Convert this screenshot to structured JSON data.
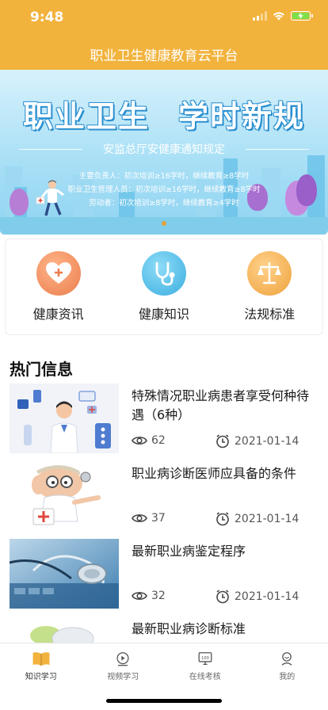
{
  "status_bar": {
    "time": "9:48"
  },
  "header": {
    "title": "职业卫生健康教育云平台"
  },
  "banner": {
    "title_left": "职业卫生",
    "title_right": "学时新规",
    "subtitle": "安监总厅安健康通知规定",
    "rules": [
      "主要负责人：初次培训≥16学时，继续教育≥8学时",
      "职业卫生管理人员：初次培训≥16学时，继续教育≥8学时",
      "劳动者：初次培训≥8学时，继续教育≥4学时"
    ]
  },
  "categories": [
    {
      "label": "健康资讯",
      "icon": "heart-plus-icon",
      "color": "#ef8e5c"
    },
    {
      "label": "健康知识",
      "icon": "stethoscope-icon",
      "color": "#45b8e6"
    },
    {
      "label": "法规标准",
      "icon": "scales-icon",
      "color": "#f1ac4a"
    }
  ],
  "section_title": "热门信息",
  "news": [
    {
      "title": "特殊情况职业病患者享受何种待遇（6种）",
      "views": "62",
      "date": "2021-01-14"
    },
    {
      "title": "职业病诊断医师应具备的条件",
      "views": "37",
      "date": "2021-01-14"
    },
    {
      "title": "最新职业病鉴定程序",
      "views": "32",
      "date": "2021-01-14"
    },
    {
      "title": "最新职业病诊断标准",
      "views": "",
      "date": ""
    }
  ],
  "tabbar": [
    {
      "label": "知识学习",
      "icon": "book-icon"
    },
    {
      "label": "视频学习",
      "icon": "video-play-icon"
    },
    {
      "label": "在线考核",
      "icon": "exam-monitor-icon"
    },
    {
      "label": "我的",
      "icon": "user-icon"
    }
  ],
  "colors": {
    "brand": "#f2b33d",
    "active_tab": "#f2b33d"
  }
}
